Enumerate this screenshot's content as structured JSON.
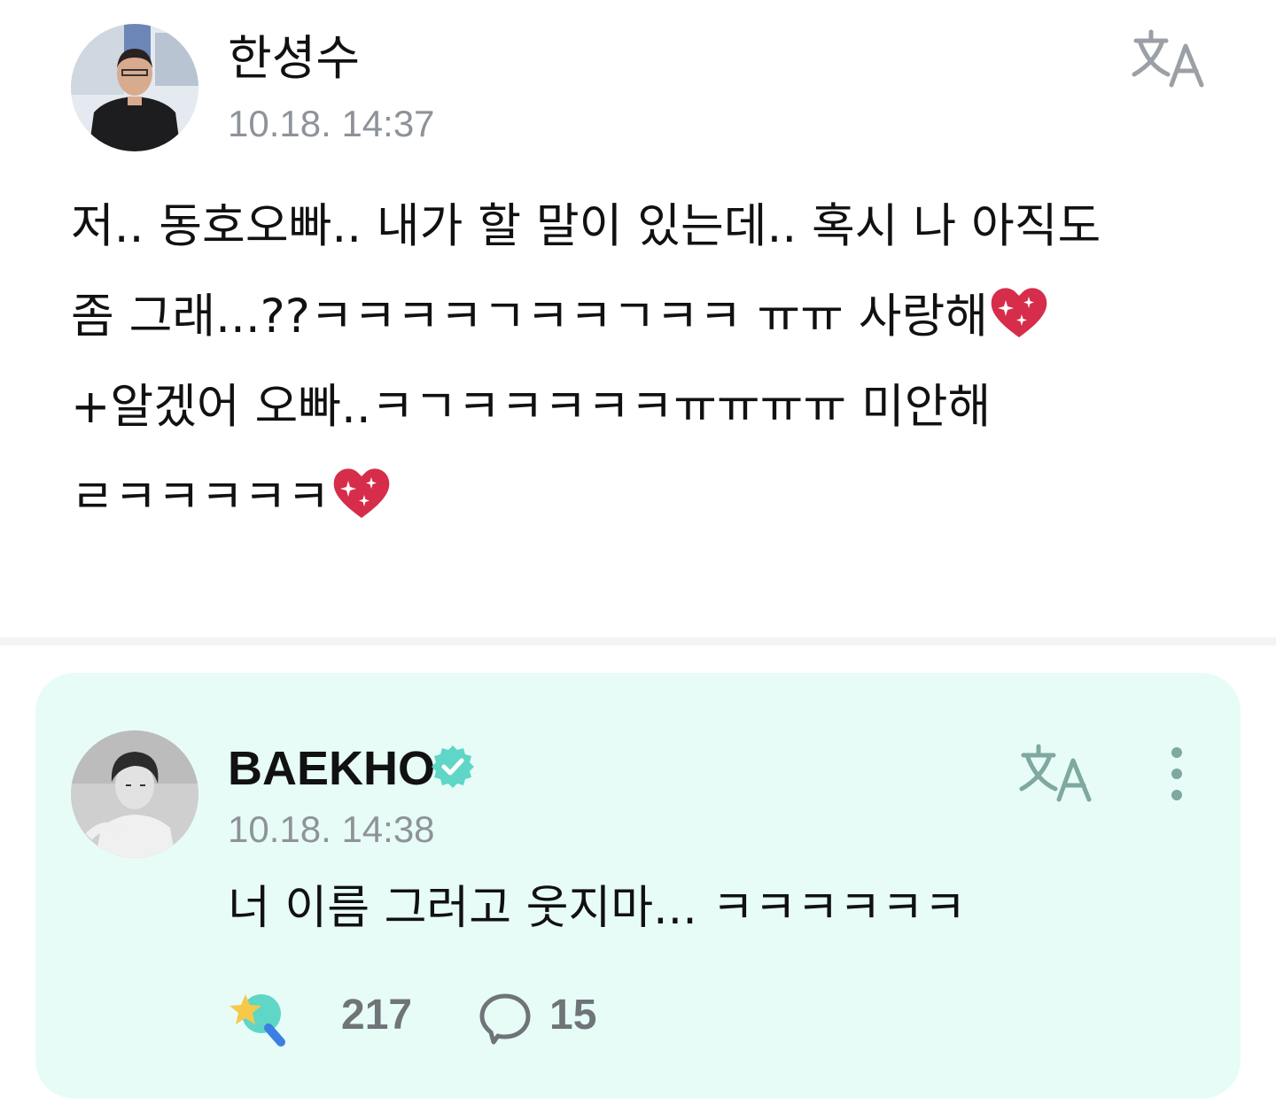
{
  "post": {
    "author_name": "한셩수",
    "timestamp": "10.18. 14:37",
    "translate_icon": "translate-icon",
    "lines": [
      "저.. 동호오빠.. 내가 할 말이 있는데.. 혹시 나 아직도",
      "좀 그래...??ㅋㅋㅋㅋㄱㅋㅋㄱㅋㅋ ㅠㅠ 사랑해",
      "+알겠어 오빠..ㅋㄱㅋㅋㅋㅋㅋㅠㅠㅠㅠ 미안해",
      "ㄹㅋㅋㅋㅋㅋ"
    ],
    "emoji_icon": "sparkling-heart-icon"
  },
  "reply": {
    "author_name": "BAEKHO",
    "verified_icon": "verified-badge-icon",
    "timestamp": "10.18. 14:38",
    "text": "너 이름 그러고 웃지마... ㅋㅋㅋㅋㅋㅋ",
    "like_count": "217",
    "comment_count": "15",
    "more_icon": "more-vertical-icon"
  },
  "colors": {
    "reply_background": "#e7fcf7",
    "accent_teal": "#5fd6c6",
    "translate_gray": "#9aa0a6",
    "translate_teal": "#7fa8a0",
    "timestamp_gray": "#8e9399"
  }
}
